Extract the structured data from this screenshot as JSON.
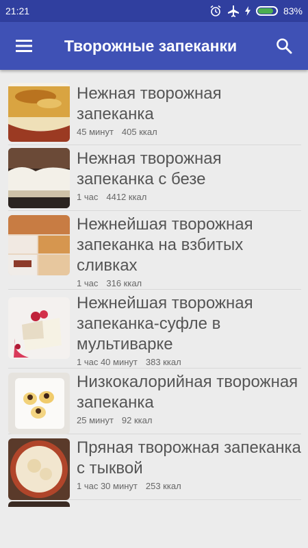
{
  "status": {
    "time": "21:21",
    "battery": "83%",
    "battery_level": 0.83
  },
  "app_bar": {
    "title": "Творожные запеканки"
  },
  "recipes": [
    {
      "title": "Нежная творожная запеканка",
      "time": "45 минут",
      "kcal": "405 ккал"
    },
    {
      "title": "Нежная творожная запеканка с безе",
      "time": "1 час",
      "kcal": "4412 ккал"
    },
    {
      "title": "Нежнейшая творожная запеканка на взбитых сливках",
      "time": "1 час",
      "kcal": "316 ккал"
    },
    {
      "title": "Нежнейшая творожная запеканка-суфле в мультиварке",
      "time": "1 час 40 минут",
      "kcal": "383 ккал"
    },
    {
      "title": "Низкокалорийная творожная запеканка",
      "time": "25 минут",
      "kcal": "92 ккал"
    },
    {
      "title": "Пряная творожная запеканка с тыквой",
      "time": "1 час 30 минут",
      "kcal": "253 ккал"
    }
  ]
}
